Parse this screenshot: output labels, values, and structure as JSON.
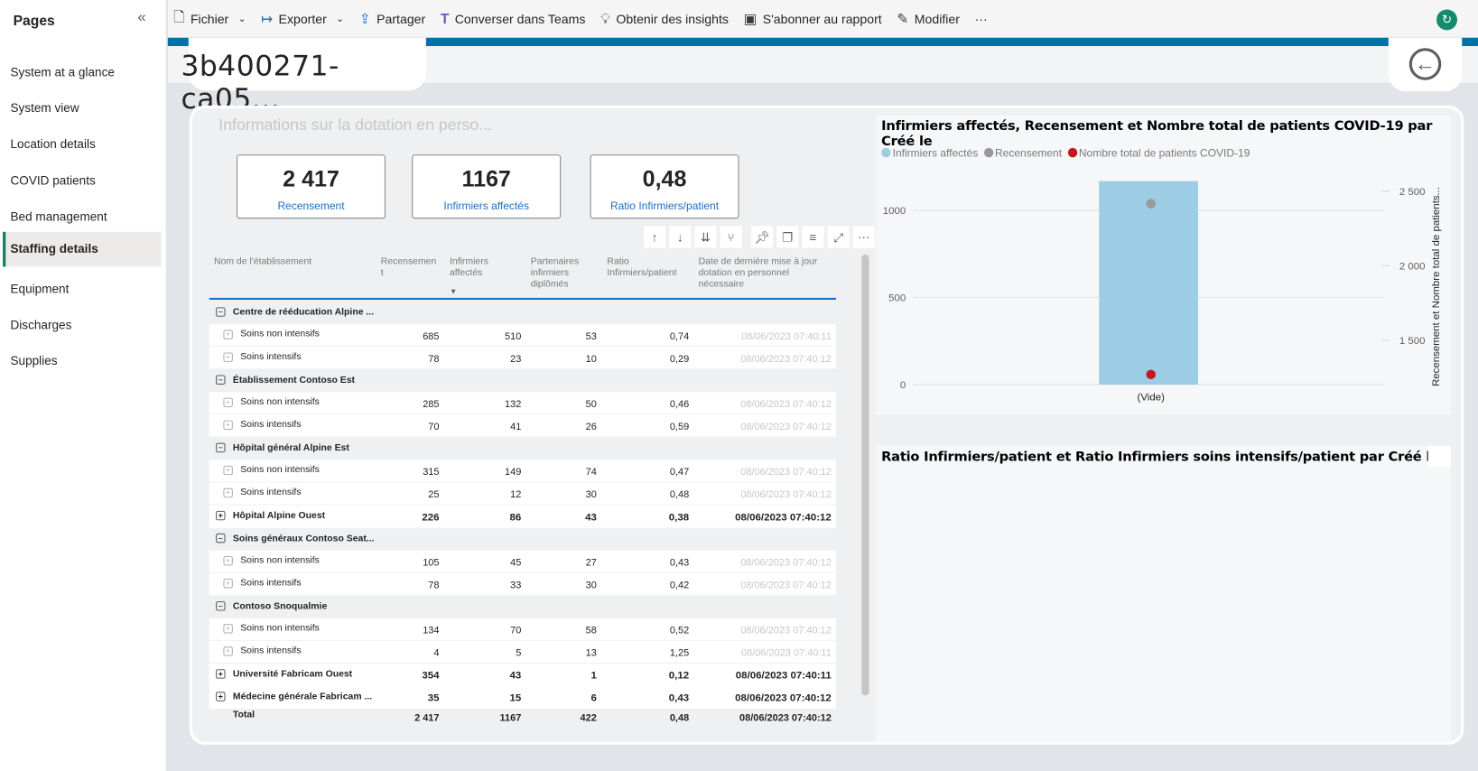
{
  "sidebar": {
    "title": "Pages",
    "items": [
      {
        "label": "System at a glance"
      },
      {
        "label": "System view"
      },
      {
        "label": "Location details"
      },
      {
        "label": "COVID patients"
      },
      {
        "label": "Bed management"
      },
      {
        "label": "Staffing details",
        "active": true
      },
      {
        "label": "Equipment"
      },
      {
        "label": "Discharges"
      },
      {
        "label": "Supplies"
      }
    ]
  },
  "toolbar": {
    "fichier": "Fichier",
    "exporter": "Exporter",
    "partager": "Partager",
    "teams": "Converser dans Teams",
    "insights": "Obtenir des insights",
    "abonner": "S'abonner au rapport",
    "modifier": "Modifier",
    "more": "···"
  },
  "report": {
    "title": "3b400271-ca05..."
  },
  "visual": {
    "title": "Informations sur la dotation en perso..."
  },
  "kpis": [
    {
      "value": "2 417",
      "label": "Recensement"
    },
    {
      "value": "1167",
      "label": "Infirmiers affectés"
    },
    {
      "value": "0,48",
      "label": "Ratio Infirmiers/patient"
    }
  ],
  "table": {
    "headers": [
      "Nom de l'établissement",
      "Recensemen t",
      "Infirmiers affectés",
      "Partenaires infirmiers diplômés",
      "Ratio Infirmiers/patient",
      "Date de dernière mise à jour dotation en personnel nécessaire"
    ],
    "rows": [
      {
        "type": "grp",
        "name": "Centre de rééducation Alpine ..."
      },
      {
        "type": "sub",
        "name": "Soins non intensifs",
        "v": [
          "685",
          "510",
          "53",
          "0,74",
          "08/06/2023 07:40:11"
        ]
      },
      {
        "type": "sub",
        "name": "Soins intensifs",
        "v": [
          "78",
          "23",
          "10",
          "0,29",
          "08/06/2023 07:40:12"
        ]
      },
      {
        "type": "grp",
        "name": "Établissement Contoso Est"
      },
      {
        "type": "sub",
        "name": "Soins non intensifs",
        "v": [
          "285",
          "132",
          "50",
          "0,46",
          "08/06/2023 07:40:12"
        ]
      },
      {
        "type": "sub",
        "name": "Soins intensifs",
        "v": [
          "70",
          "41",
          "26",
          "0,59",
          "08/06/2023 07:40:12"
        ]
      },
      {
        "type": "grp",
        "name": "Hôpital général Alpine Est"
      },
      {
        "type": "sub",
        "name": "Soins non intensifs",
        "v": [
          "315",
          "149",
          "74",
          "0,47",
          "08/06/2023 07:40:12"
        ]
      },
      {
        "type": "sub",
        "name": "Soins intensifs",
        "v": [
          "25",
          "12",
          "30",
          "0,48",
          "08/06/2023 07:40:12"
        ]
      },
      {
        "type": "bold",
        "name": "Hôpital Alpine Ouest",
        "v": [
          "226",
          "86",
          "43",
          "0,38",
          "08/06/2023 07:40:12"
        ]
      },
      {
        "type": "grp",
        "name": "Soins généraux Contoso Seat..."
      },
      {
        "type": "sub",
        "name": "Soins non intensifs",
        "v": [
          "105",
          "45",
          "27",
          "0,43",
          "08/06/2023 07:40:12"
        ]
      },
      {
        "type": "sub",
        "name": "Soins intensifs",
        "v": [
          "78",
          "33",
          "30",
          "0,42",
          "08/06/2023 07:40:12"
        ]
      },
      {
        "type": "grp",
        "name": "Contoso Snoqualmie"
      },
      {
        "type": "sub",
        "name": "Soins non intensifs",
        "v": [
          "134",
          "70",
          "58",
          "0,52",
          "08/06/2023 07:40:12"
        ]
      },
      {
        "type": "sub",
        "name": "Soins intensifs",
        "v": [
          "4",
          "5",
          "13",
          "1,25",
          "08/06/2023 07:40:11"
        ]
      },
      {
        "type": "bold",
        "name": "Université Fabricam Ouest",
        "v": [
          "354",
          "43",
          "1",
          "0,12",
          "08/06/2023 07:40:11"
        ]
      },
      {
        "type": "bold",
        "name": "Médecine générale Fabricam ...",
        "v": [
          "35",
          "15",
          "6",
          "0,43",
          "08/06/2023 07:40:12"
        ]
      },
      {
        "type": "total",
        "name": "Total",
        "v": [
          "2 417",
          "1167",
          "422",
          "0,48",
          "08/06/2023 07:40:12"
        ]
      }
    ]
  },
  "chart_data": [
    {
      "type": "bar+scatter",
      "title": "Infirmiers affectés, Recensement et Nombre total de patients COVID-19 par Créé le",
      "categories": [
        "(Vide)"
      ],
      "series": [
        {
          "name": "Infirmiers affectés",
          "type": "bar",
          "axis": "left",
          "values": [
            1167
          ],
          "color": "#9ccde4"
        },
        {
          "name": "Recensement",
          "type": "point",
          "axis": "right",
          "values": [
            2417
          ],
          "color": "#999999"
        },
        {
          "name": "Nombre total de patients COVID-19",
          "type": "point",
          "axis": "right",
          "values": [
            1270
          ],
          "color": "#c4161c"
        }
      ],
      "left_axis": {
        "ticks": [
          0,
          500,
          1000
        ],
        "tick_labels": [
          "0",
          "500",
          "1000"
        ],
        "range": [
          0,
          1200
        ]
      },
      "right_axis": {
        "ticks": [
          1500,
          2000,
          2500
        ],
        "tick_labels": [
          "1 500",
          "2 000",
          "2 500"
        ],
        "label": "Recensement et Nombre total de patients...",
        "range": [
          1200,
          2630
        ]
      },
      "legend": "top-left",
      "grid": true
    },
    {
      "type": "line",
      "title": "Ratio Infirmiers/patient et Ratio Infirmiers soins intensifs/patient par Créé le"
    }
  ]
}
